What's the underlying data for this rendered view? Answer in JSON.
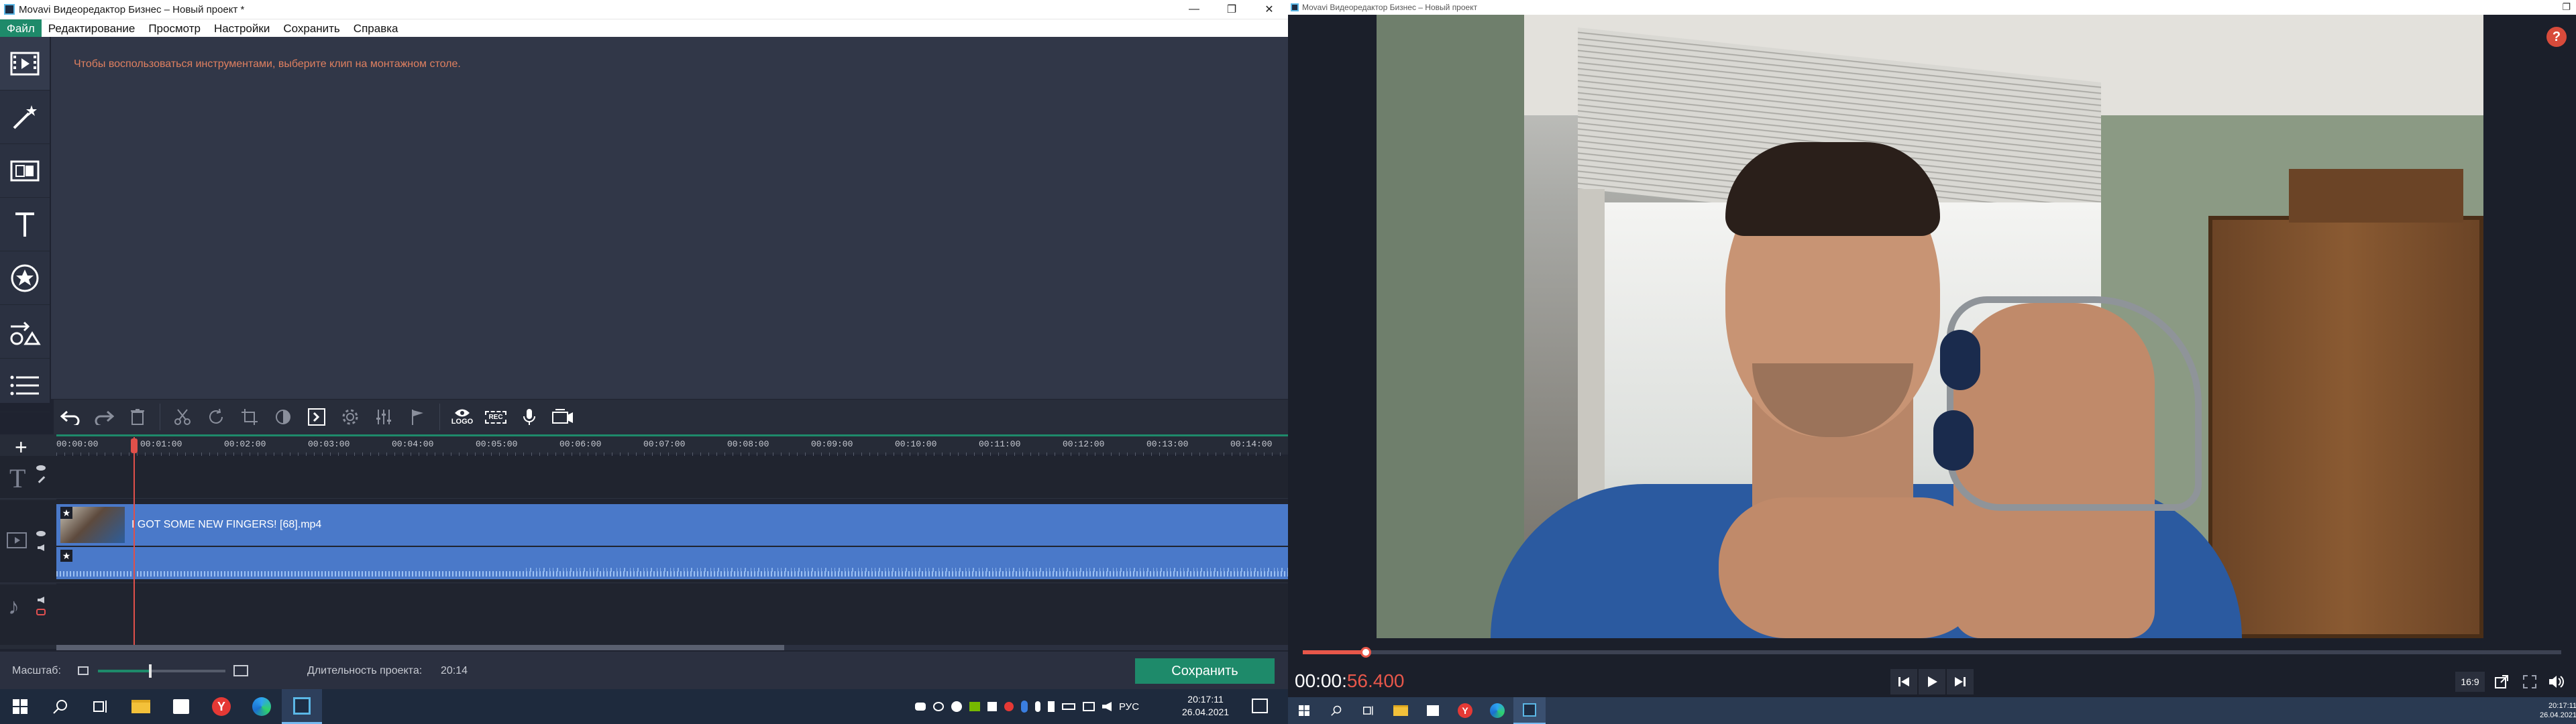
{
  "left_window": {
    "title": "Movavi Видеоредактор Бизнес – Новый проект *",
    "menu": [
      "Файл",
      "Редактирование",
      "Просмотр",
      "Настройки",
      "Сохранить",
      "Справка"
    ],
    "hint": "Чтобы воспользоваться инструментами, выберите клип на монтажном столе.",
    "sidebar_tools": [
      "film-import-icon",
      "magic-wand-icon",
      "transitions-icon",
      "titles-icon",
      "stickers-icon",
      "shapes-icon",
      "more-tools-icon"
    ],
    "toolbar_labels": {
      "logo": "LOGO",
      "rec": "REC"
    },
    "ruler_ticks": [
      "00:00:00",
      "00:01:00",
      "00:02:00",
      "00:03:00",
      "00:04:00",
      "00:05:00",
      "00:06:00",
      "00:07:00",
      "00:08:00",
      "00:09:00",
      "00:10:00",
      "00:11:00",
      "00:12:00",
      "00:13:00",
      "00:14:00"
    ],
    "clip_name": "I GOT SOME NEW FINGERS! [68].mp4",
    "scale_label": "Масштаб:",
    "duration_label": "Длительность проекта:",
    "duration_value": "20:14",
    "save_button": "Сохранить"
  },
  "right_window": {
    "title": "Movavi Видеоредактор Бизнес – Новый проект",
    "help": "?",
    "timecode_white": "00:00:",
    "timecode_red": "56.400",
    "aspect": "16:9",
    "progress": 0.05
  },
  "taskbar": {
    "left": {
      "time": "20:17:11",
      "date": "26.04.2021",
      "lang": "РУС"
    },
    "right": {
      "time": "20:17:11",
      "date": "26.04.2021"
    }
  },
  "colors": {
    "accent": "#1e8a6a",
    "clip": "#4a79c9",
    "hint": "#e08060",
    "timecode_red": "#e8574a"
  }
}
